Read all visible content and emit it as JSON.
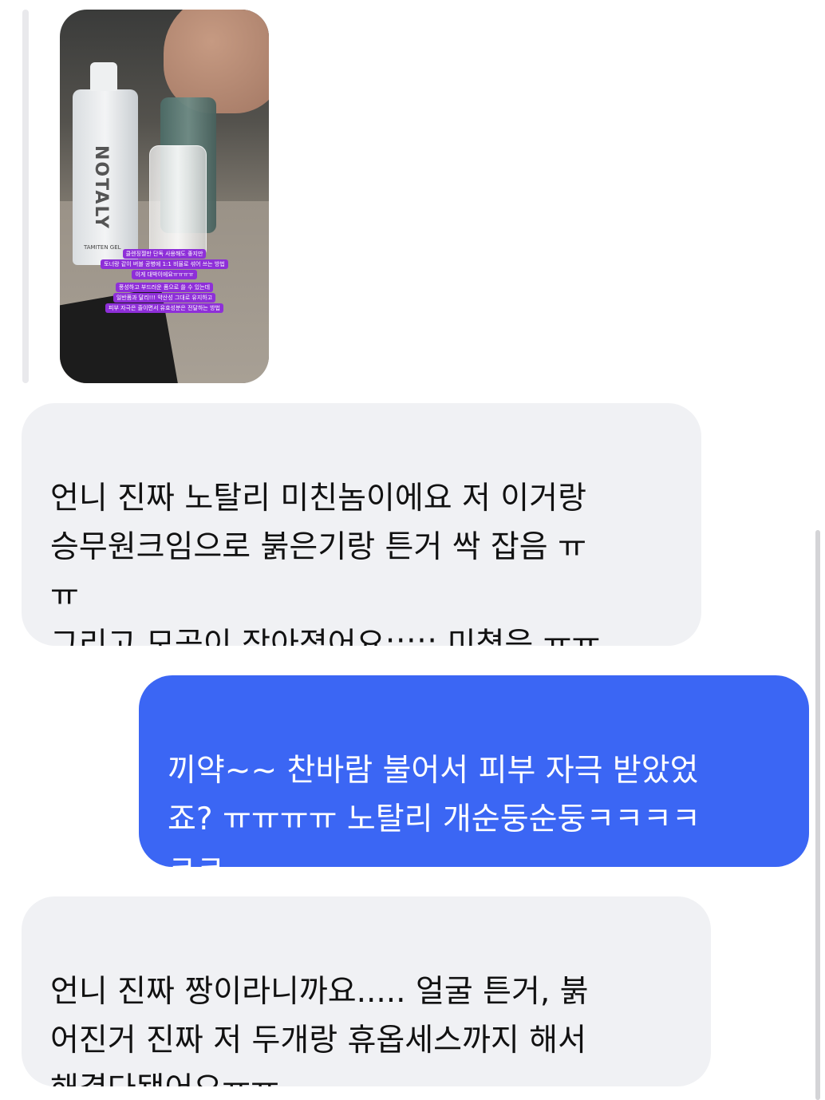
{
  "story_reply": {
    "image_alt": "story-photo-cosmetics",
    "bottle_brand": "NOTALY",
    "bottle_sub": "TAMITEN GEL",
    "caption_lines": [
      "클렌징젤만 단독 사용해도 좋지만",
      "토너랑 같이 버블 공병에 1:1 비율로 섞어 쓰는 방법",
      "이게 대박이에요ㅠㅠㅠㅠ",
      "풍성하고 부드러운 폼으로 쓸 수 있는데",
      "일반폼과 달리!!! 약산성 그대로 유지하고",
      "피부 자극은 줄이면서 유효성분은 전달하는 방법"
    ]
  },
  "messages": [
    {
      "side": "incoming",
      "text": "언니 진짜 노탈리 미친놈이에요 저 이거랑\n승무원크임으로 붉은기랑 튼거 싹 잡음 ㅠ\nㅠ\n그리고 모공이 작아졌어요;;;;; 미쳤음 ㅠㅠ"
    },
    {
      "side": "outgoing",
      "text": "끼약~~ 찬바람 불어서 피부 자극 받았었\n죠? ㅠㅠㅠㅠ 노탈리 개순둥순둥ㅋㅋㅋㅋ\nㅋㅋ"
    },
    {
      "side": "incoming",
      "text": "언니 진짜 짱이라니까요..... 얼굴 튼거, 붉\n어진거  진짜 저 두개랑 휴옵세스까지 해서\n해결다됐어요ㅠㅠ"
    }
  ],
  "colors": {
    "incoming_bg": "#f0f1f4",
    "outgoing_bg": "#3b66f4",
    "caption_bg": "#8e2fd8"
  }
}
